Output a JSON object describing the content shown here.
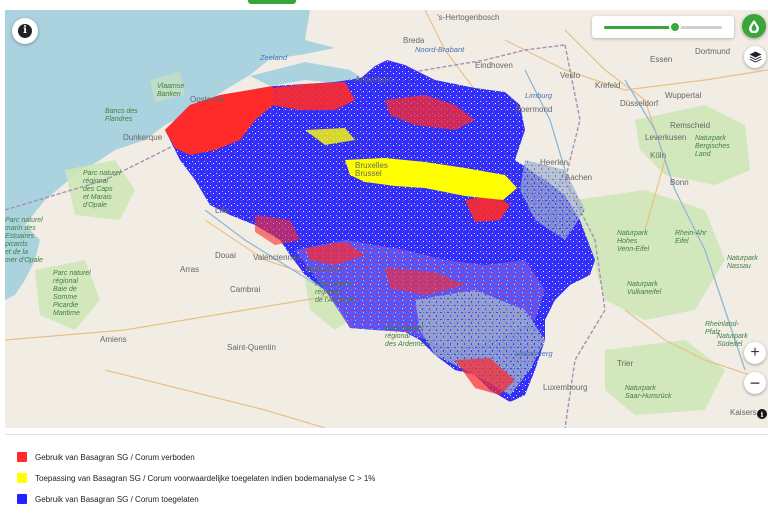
{
  "colors": {
    "forbidden": "#ff2a2a",
    "conditional": "#ffff00",
    "allowed": "#2323ff",
    "accent": "#3aa53a",
    "sea": "#aad3df",
    "land": "#f1ede4"
  },
  "controls": {
    "info_icon": "i",
    "drop_icon": "drop-icon",
    "layers_icon": "layers-icon",
    "zoom_in": "+",
    "zoom_out": "−",
    "attribution_icon": "i",
    "opacity_slider_value": 0.6
  },
  "map_labels": {
    "s_hertogenbosch": "'s-Hertogenbosch",
    "breda": "Breda",
    "noord_brabant": "Noord-Brabant",
    "eindhoven": "Eindhoven",
    "dortmund": "Dortmund",
    "essen": "Essen",
    "zeeland": "Zeeland",
    "venlo": "Venlo",
    "krefeld": "Krefeld",
    "wuppertal": "Wuppertal",
    "dusseldorf": "Düsseldorf",
    "vlaamse_banken": "Vlaamse\nBanken",
    "bancs_de_flandres": "Bancs des\nFlandres",
    "oostende": "Oostende",
    "antwerpen": "Antwerpen",
    "limburg": "Limburg",
    "roermond": "Roermond",
    "remscheid": "Remscheid",
    "leverkusen": "Leverkusen",
    "naturpark_bergisches_land": "Naturpark\nBergisches\nLand",
    "dunkerque": "Dunkerque",
    "koln": "Köln",
    "heerlen": "Heerlen",
    "aachen": "Aachen",
    "bonn": "Bonn",
    "bruxelles": "Bruxelles\nBrussel",
    "parc_caps": "Parc naturel\nrégional\ndes Caps\net Marais\nd'Opale",
    "parc_estuaires": "Parc naturel\nmarin des\nEstuaires\npicards\net de la\nmer d'Opale",
    "lille": "Lille",
    "naturpark_hohes_venn": "Naturpark\nHohes\nVenn-Eifel",
    "rhein_ahr": "Rhein-Ahr\nEifel",
    "douai": "Douai",
    "valenciennes": "Valenciennes",
    "arras": "Arras",
    "maubeuge": "Maubeuge",
    "parc_somme": "Parc naturel\nrégional\nBaie de\nSomme\nPicardie\nMaritime",
    "cambrai": "Cambrai",
    "parc_avesnois": "Parc naturel\nrégional\nde l'Avesnois",
    "naturpark_vulkaneifel": "Naturpark\nVulkaneifel",
    "parc_ardennes": "Parc naturel\nrégional\ndes Ardennes",
    "amiens": "Amiens",
    "saint_quentin": "Saint-Quentin",
    "rhein": "Rheinland-\nPfalz",
    "naturpark_saar": "Naturpark\nSaar-Hunsrück",
    "luxembourg_region": "Lëtzebuerg",
    "luxembourg_city": "Luxembourg",
    "trier": "Trier",
    "kaisers": "Kaisers",
    "naturpark_sudeifel": "Naturpark\nSüdeifel",
    "naturpark_nassau": "Naturpark\nNassau"
  },
  "legend": [
    {
      "label": "Gebruik van Basagran SG / Corum verboden",
      "color": "#ff2a2a"
    },
    {
      "label": "Toepassing van Basagran SG / Corum voorwaardelijke toegelaten indien bodemanalyse C > 1%",
      "color": "#ffff00"
    },
    {
      "label": "Gebruik van Basagran SG / Corum toegelaten",
      "color": "#2323ff"
    }
  ]
}
